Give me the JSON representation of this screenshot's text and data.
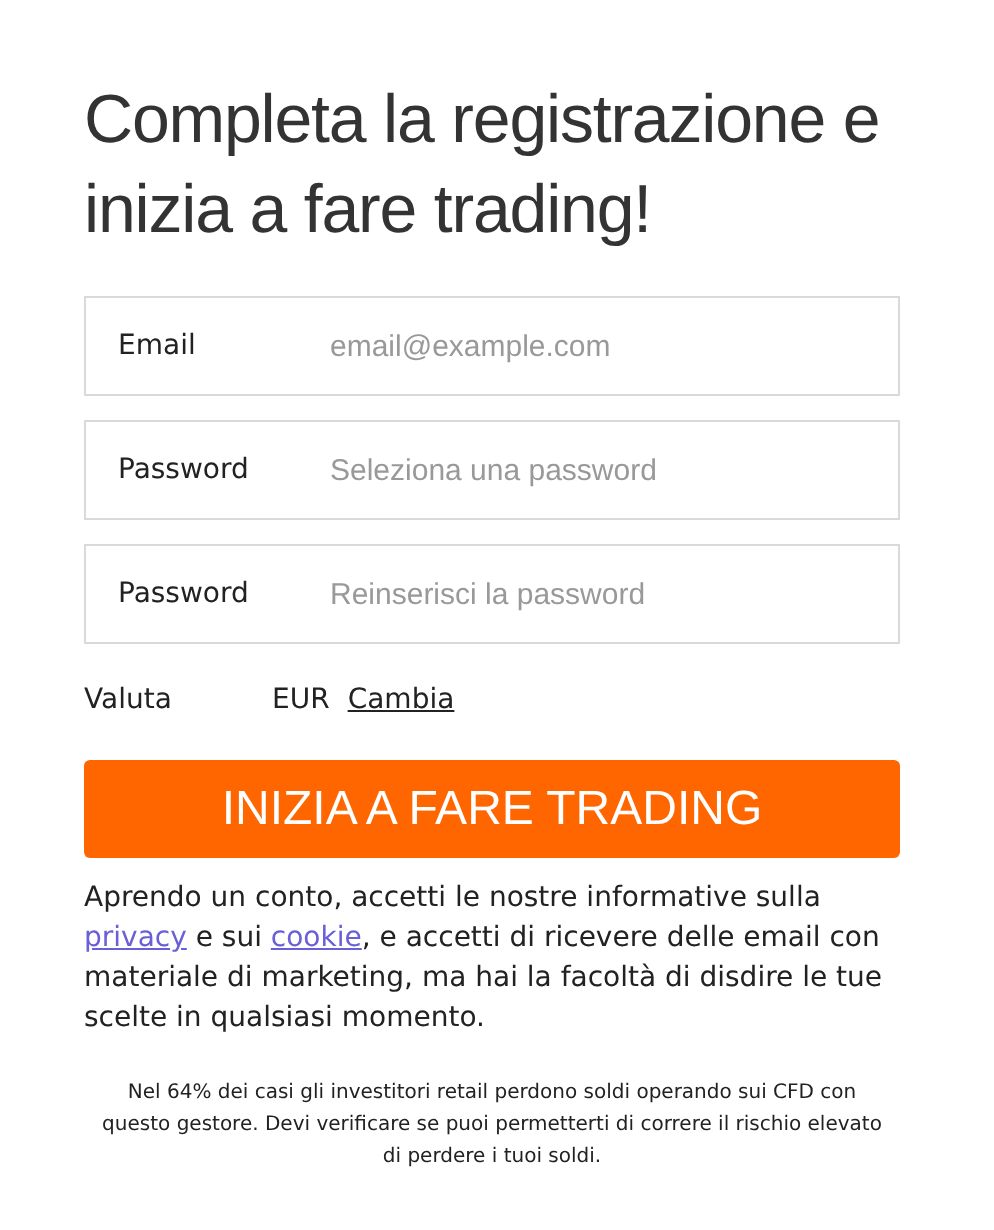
{
  "title": "Completa la registrazione e inizia a fare trading!",
  "fields": [
    {
      "label": "Email",
      "placeholder": "email@example.com"
    },
    {
      "label": "Password",
      "placeholder": "Seleziona una password"
    },
    {
      "label": "Password",
      "placeholder": "Reinserisci la password"
    }
  ],
  "currency": {
    "label": "Valuta",
    "value": "EUR",
    "link": "Cambia"
  },
  "submit_button": "INIZIA A FARE TRADING",
  "consent": [
    {
      "kind": "text",
      "text": "Aprendo un conto, accetti le nostre informative sulla "
    },
    {
      "kind": "link",
      "text": "privacy"
    },
    {
      "kind": "text",
      "text": " e sui "
    },
    {
      "kind": "link",
      "text": "cookie"
    },
    {
      "kind": "text",
      "text": ", e accetti di ricevere delle email con materiale di marketing, ma hai la facoltà di disdire le tue scelte in qualsiasi momento."
    }
  ],
  "risk_warning": "Nel 64% dei casi gli investitori retail perdono soldi operando sui CFD con questo gestore. Devi verificare se puoi permetterti di correre il rischio elevato di perdere i tuoi soldi."
}
